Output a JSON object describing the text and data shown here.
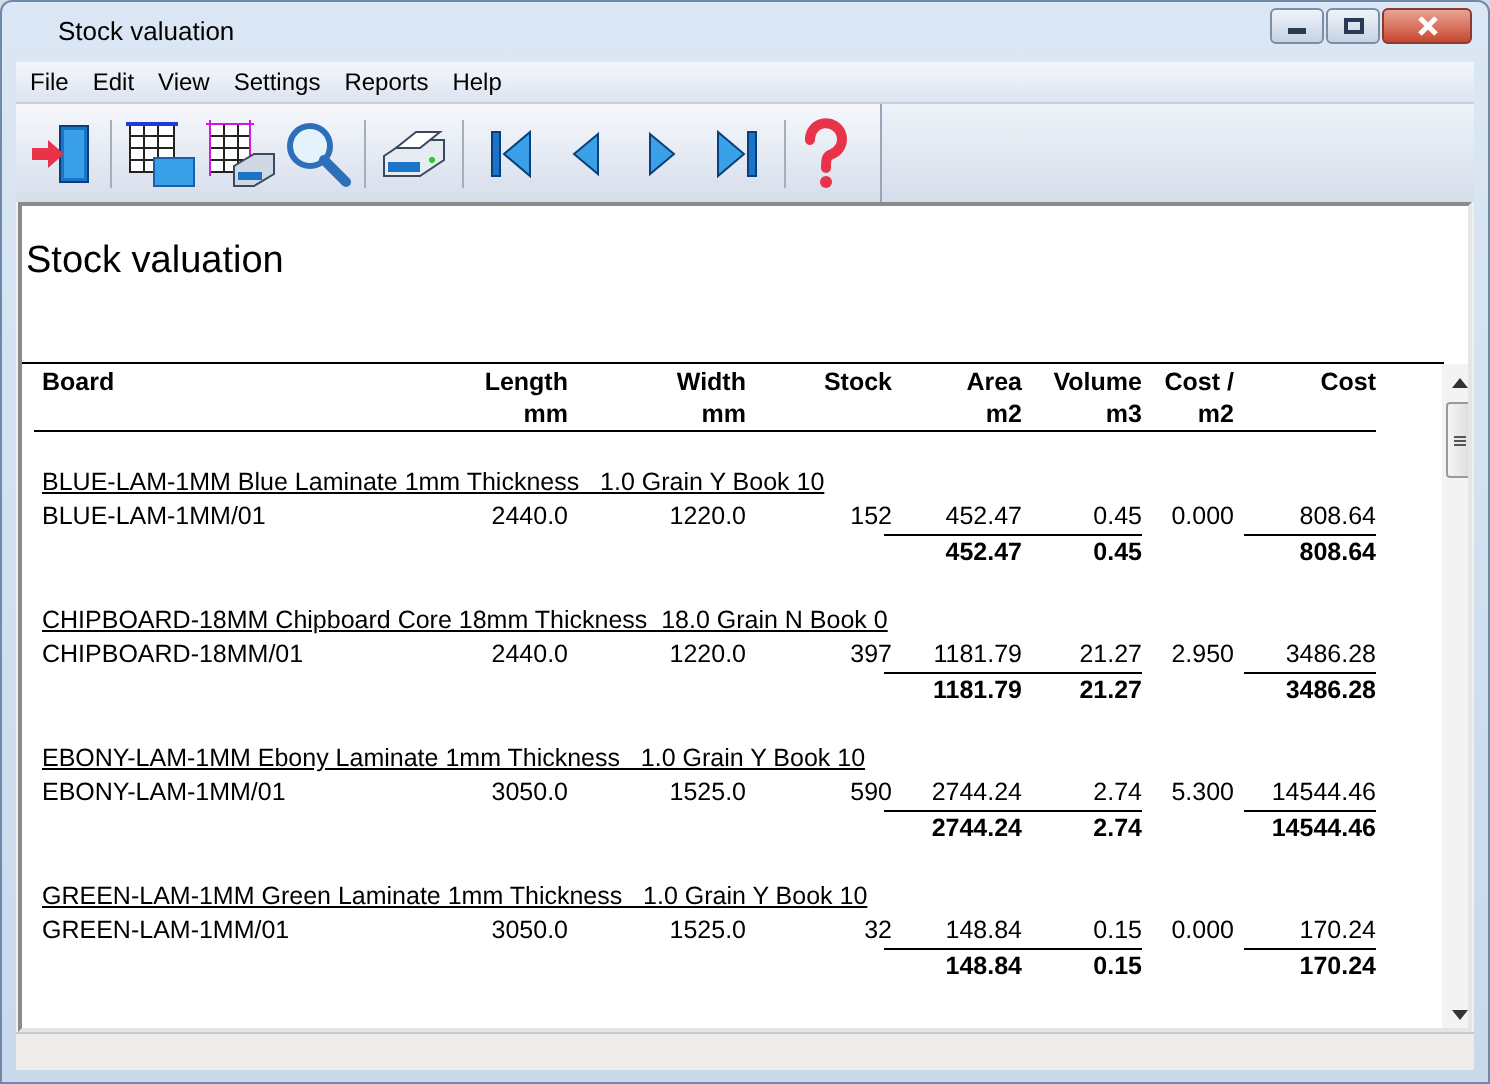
{
  "window": {
    "title": "Stock valuation"
  },
  "menu": [
    "File",
    "Edit",
    "View",
    "Settings",
    "Reports",
    "Help"
  ],
  "report": {
    "title": "Stock valuation",
    "columns": [
      {
        "label": "Board"
      },
      {
        "label": "Length",
        "unit": "mm"
      },
      {
        "label": "Width",
        "unit": "mm"
      },
      {
        "label": "Stock"
      },
      {
        "label": "Area",
        "unit": "m2"
      },
      {
        "label": "Volume",
        "unit": "m3"
      },
      {
        "label": "Cost /",
        "unit": "m2"
      },
      {
        "label": "Cost"
      }
    ],
    "groups": [
      {
        "heading": "BLUE-LAM-1MM Blue Laminate 1mm Thickness   1.0 Grain Y Book 10",
        "row": [
          "BLUE-LAM-1MM/01",
          "2440.0",
          "1220.0",
          "152",
          "452.47",
          "0.45",
          "0.000",
          "808.64"
        ],
        "totals": {
          "area": "452.47",
          "volume": "0.45",
          "cost": "808.64"
        }
      },
      {
        "heading": "CHIPBOARD-18MM Chipboard Core 18mm Thickness  18.0 Grain N Book 0",
        "row": [
          "CHIPBOARD-18MM/01",
          "2440.0",
          "1220.0",
          "397",
          "1181.79",
          "21.27",
          "2.950",
          "3486.28"
        ],
        "totals": {
          "area": "1181.79",
          "volume": "21.27",
          "cost": "3486.28"
        }
      },
      {
        "heading": "EBONY-LAM-1MM Ebony Laminate 1mm Thickness   1.0 Grain Y Book 10",
        "row": [
          "EBONY-LAM-1MM/01",
          "3050.0",
          "1525.0",
          "590",
          "2744.24",
          "2.74",
          "5.300",
          "14544.46"
        ],
        "totals": {
          "area": "2744.24",
          "volume": "2.74",
          "cost": "14544.46"
        }
      },
      {
        "heading": "GREEN-LAM-1MM Green Laminate 1mm Thickness   1.0 Grain Y Book 10",
        "row": [
          "GREEN-LAM-1MM/01",
          "3050.0",
          "1525.0",
          "32",
          "148.84",
          "0.15",
          "0.000",
          "170.24"
        ],
        "totals": {
          "area": "148.84",
          "volume": "0.15",
          "cost": "170.24"
        }
      }
    ]
  }
}
